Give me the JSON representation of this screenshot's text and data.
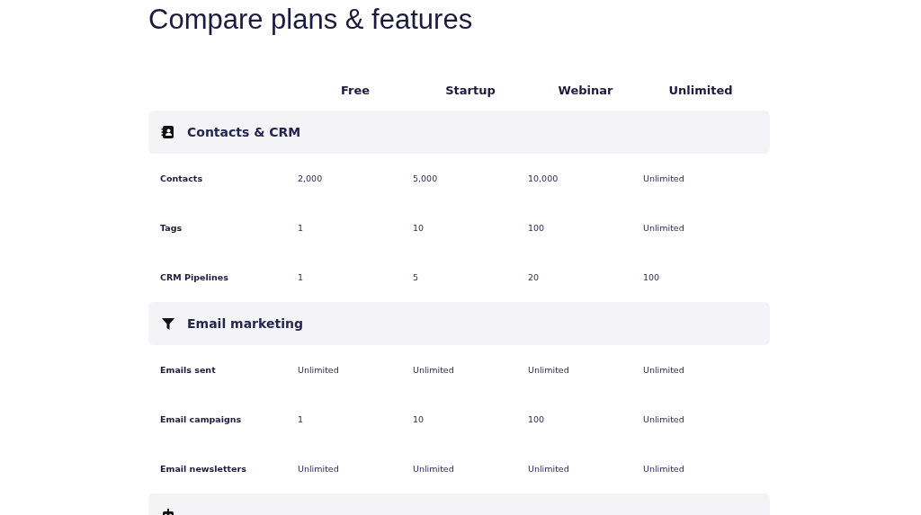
{
  "title": "Compare plans & features",
  "plans": [
    "Free",
    "Startup",
    "Webinar",
    "Unlimited"
  ],
  "sections": [
    {
      "kind": "contacts",
      "title": "Contacts & CRM",
      "rows": [
        {
          "label": "Contacts",
          "values": [
            "2,000",
            "5,000",
            "10,000",
            "Unlimited"
          ]
        },
        {
          "label": "Tags",
          "values": [
            "1",
            "10",
            "100",
            "Unlimited"
          ]
        },
        {
          "label": "CRM Pipelines",
          "values": [
            "1",
            "5",
            "20",
            "100"
          ]
        }
      ]
    },
    {
      "kind": "funnel",
      "title": "Email marketing",
      "rows": [
        {
          "label": "Emails sent",
          "values": [
            "Unlimited",
            "Unlimited",
            "Unlimited",
            "Unlimited"
          ]
        },
        {
          "label": "Email campaigns",
          "values": [
            "1",
            "10",
            "100",
            "Unlimited"
          ]
        },
        {
          "label": "Email newsletters",
          "values": [
            "Unlimited",
            "Unlimited",
            "Unlimited",
            "Unlimited"
          ]
        }
      ]
    },
    {
      "kind": "robot"
    }
  ]
}
